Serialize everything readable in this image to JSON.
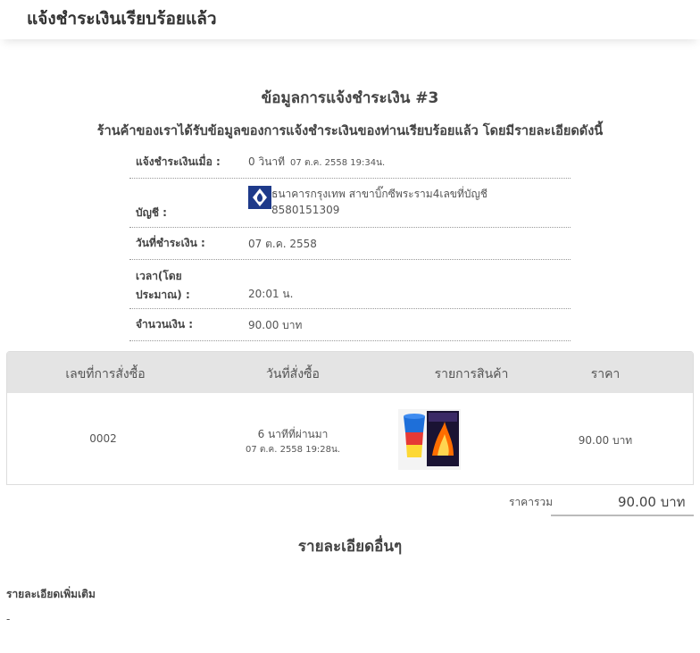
{
  "header": {
    "title": "แจ้งชำระเงินเรียบร้อยแล้ว"
  },
  "section": {
    "title": "ข้อมูลการแจ้งชำระเงิน #3",
    "subtitle": "ร้านค้าของเราได้รับข้อมูลของการแจ้งชำระเงินของท่านเรียบร้อยแล้ว โดยมีรายละเอียดดังนี้"
  },
  "info": {
    "notified_label": "แจ้งชำระเงินเมื่อ :",
    "notified_value": "0 วินาที",
    "notified_datetime": "07 ต.ค. 2558 19:34น.",
    "account_label": "บัญชี :",
    "account_line1": "ธนาคารกรุงเทพ สาขาบิ๊กซีพระราม4เลขที่บัญชี",
    "account_line2": "8580151309",
    "paid_date_label": "วันที่ชำระเงิน :",
    "paid_date_value": "07 ต.ค. 2558",
    "time_label_1": "เวลา(โดย",
    "time_label_2": "ประมาณ) :",
    "time_value": "20:01 น.",
    "amount_label": "จำนวนเงิน :",
    "amount_value": "90.00 บาท"
  },
  "order_table": {
    "headers": [
      "เลขที่การสั่งซื้อ",
      "วันที่สั่งซื้อ",
      "รายการสินค้า",
      "ราคา"
    ],
    "row": {
      "order_no": "0002",
      "relative_time": "6 นาทีที่ผ่านมา",
      "order_datetime": "07 ต.ค. 2558 19:28น.",
      "price": "90.00 บาท"
    }
  },
  "total": {
    "label": "ราคารวม",
    "value": "90.00 บาท"
  },
  "other": {
    "title": "รายละเอียดอื่นๆ",
    "extra_label": "รายละเอียดเพิ่มเติม",
    "extra_value": "-"
  },
  "colors": {
    "bank_blue": "#1e3a8a",
    "table_header_bg": "#e4e4e4"
  },
  "icons": {
    "bank": "bangkok-bank-logo-icon",
    "product": "product-thumbnail"
  }
}
